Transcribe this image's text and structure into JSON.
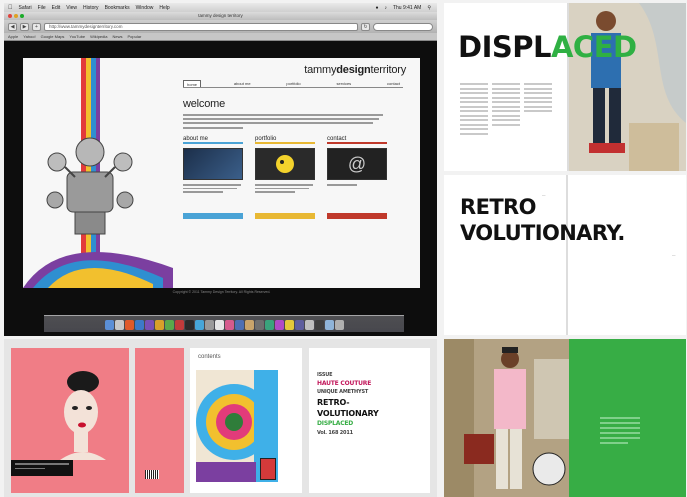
{
  "menubar": {
    "items": [
      "Safari",
      "File",
      "Edit",
      "View",
      "History",
      "Bookmarks",
      "Window",
      "Help"
    ],
    "clock": "Thu 9:41 AM"
  },
  "browser": {
    "window_title": "tammy design territory",
    "url": "http://www.tammydesignterritory.com",
    "bookmarks": [
      "Apple",
      "Yahoo!",
      "Google Maps",
      "YouTube",
      "Wikipedia",
      "News",
      "Popular"
    ]
  },
  "site": {
    "brand_light": "tammy",
    "brand_bold": "design",
    "brand_tail": "territory",
    "nav": [
      "home",
      "about me",
      "portfolio",
      "services",
      "contact"
    ],
    "welcome": "welcome",
    "cards": [
      {
        "title": "about me",
        "color": "#4aa3d6"
      },
      {
        "title": "portfolio",
        "color": "#e8b833"
      },
      {
        "title": "contact",
        "color": "#c0392b"
      }
    ],
    "footer": "Copyright © 2011 Tammy Design Territory. All Rights Reserved."
  },
  "spread_displaced": {
    "word_black": "DISPL",
    "word_green": "ACED",
    "accent": "#2fb043"
  },
  "spread_retro": {
    "line1": "RETRO",
    "line2": "VOLUTIONARY."
  },
  "print": {
    "contents_title": "contents",
    "title_lines": [
      "ISSUE",
      "HAUTE COUTURE",
      "UNIQUE AMETHYST",
      "RETRO-",
      "VOLUTIONARY",
      "DISPLACED",
      "Vol. 168 2011"
    ]
  },
  "spread_green": {
    "accent": "#37ad45"
  }
}
